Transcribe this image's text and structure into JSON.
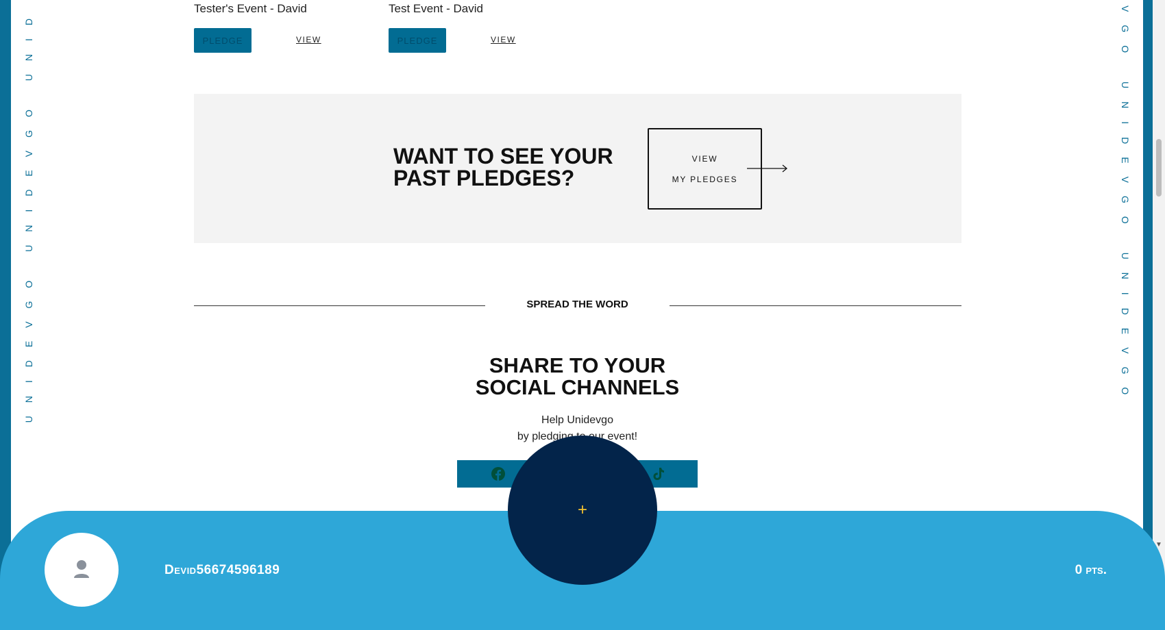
{
  "side_marquee": {
    "left_text": "UNIDEVGO UNIDEVGO UNID",
    "right_text": "VGO UNIDEVGO UNIDEVGO"
  },
  "events": [
    {
      "name": "Tester's Event - David",
      "pledge_label": "PLEDGE",
      "view_label": "VIEW"
    },
    {
      "name": "Test Event - David",
      "pledge_label": "PLEDGE",
      "view_label": "VIEW"
    }
  ],
  "past_pledges": {
    "heading": "WANT TO SEE YOUR PAST PLEDGES?",
    "button_line1": "VIEW",
    "button_line2": "MY PLEDGES"
  },
  "spread": {
    "label": "SPREAD THE WORD"
  },
  "share": {
    "title_line1": "SHARE TO YOUR",
    "title_line2": "SOCIAL CHANNELS",
    "help_line1": "Help Unidevgo",
    "help_line2": "by pledging to our event!",
    "icons": [
      "facebook-icon",
      "tiktok-icon"
    ]
  },
  "footer": {
    "username": "Devid56674596189",
    "points": "0 pts.",
    "fab_symbol": "+"
  },
  "colors": {
    "brand_dark": "#026c93",
    "footer_blue": "#2ea7d8",
    "fab_navy": "#03244a",
    "plus_yellow": "#f2c230"
  }
}
